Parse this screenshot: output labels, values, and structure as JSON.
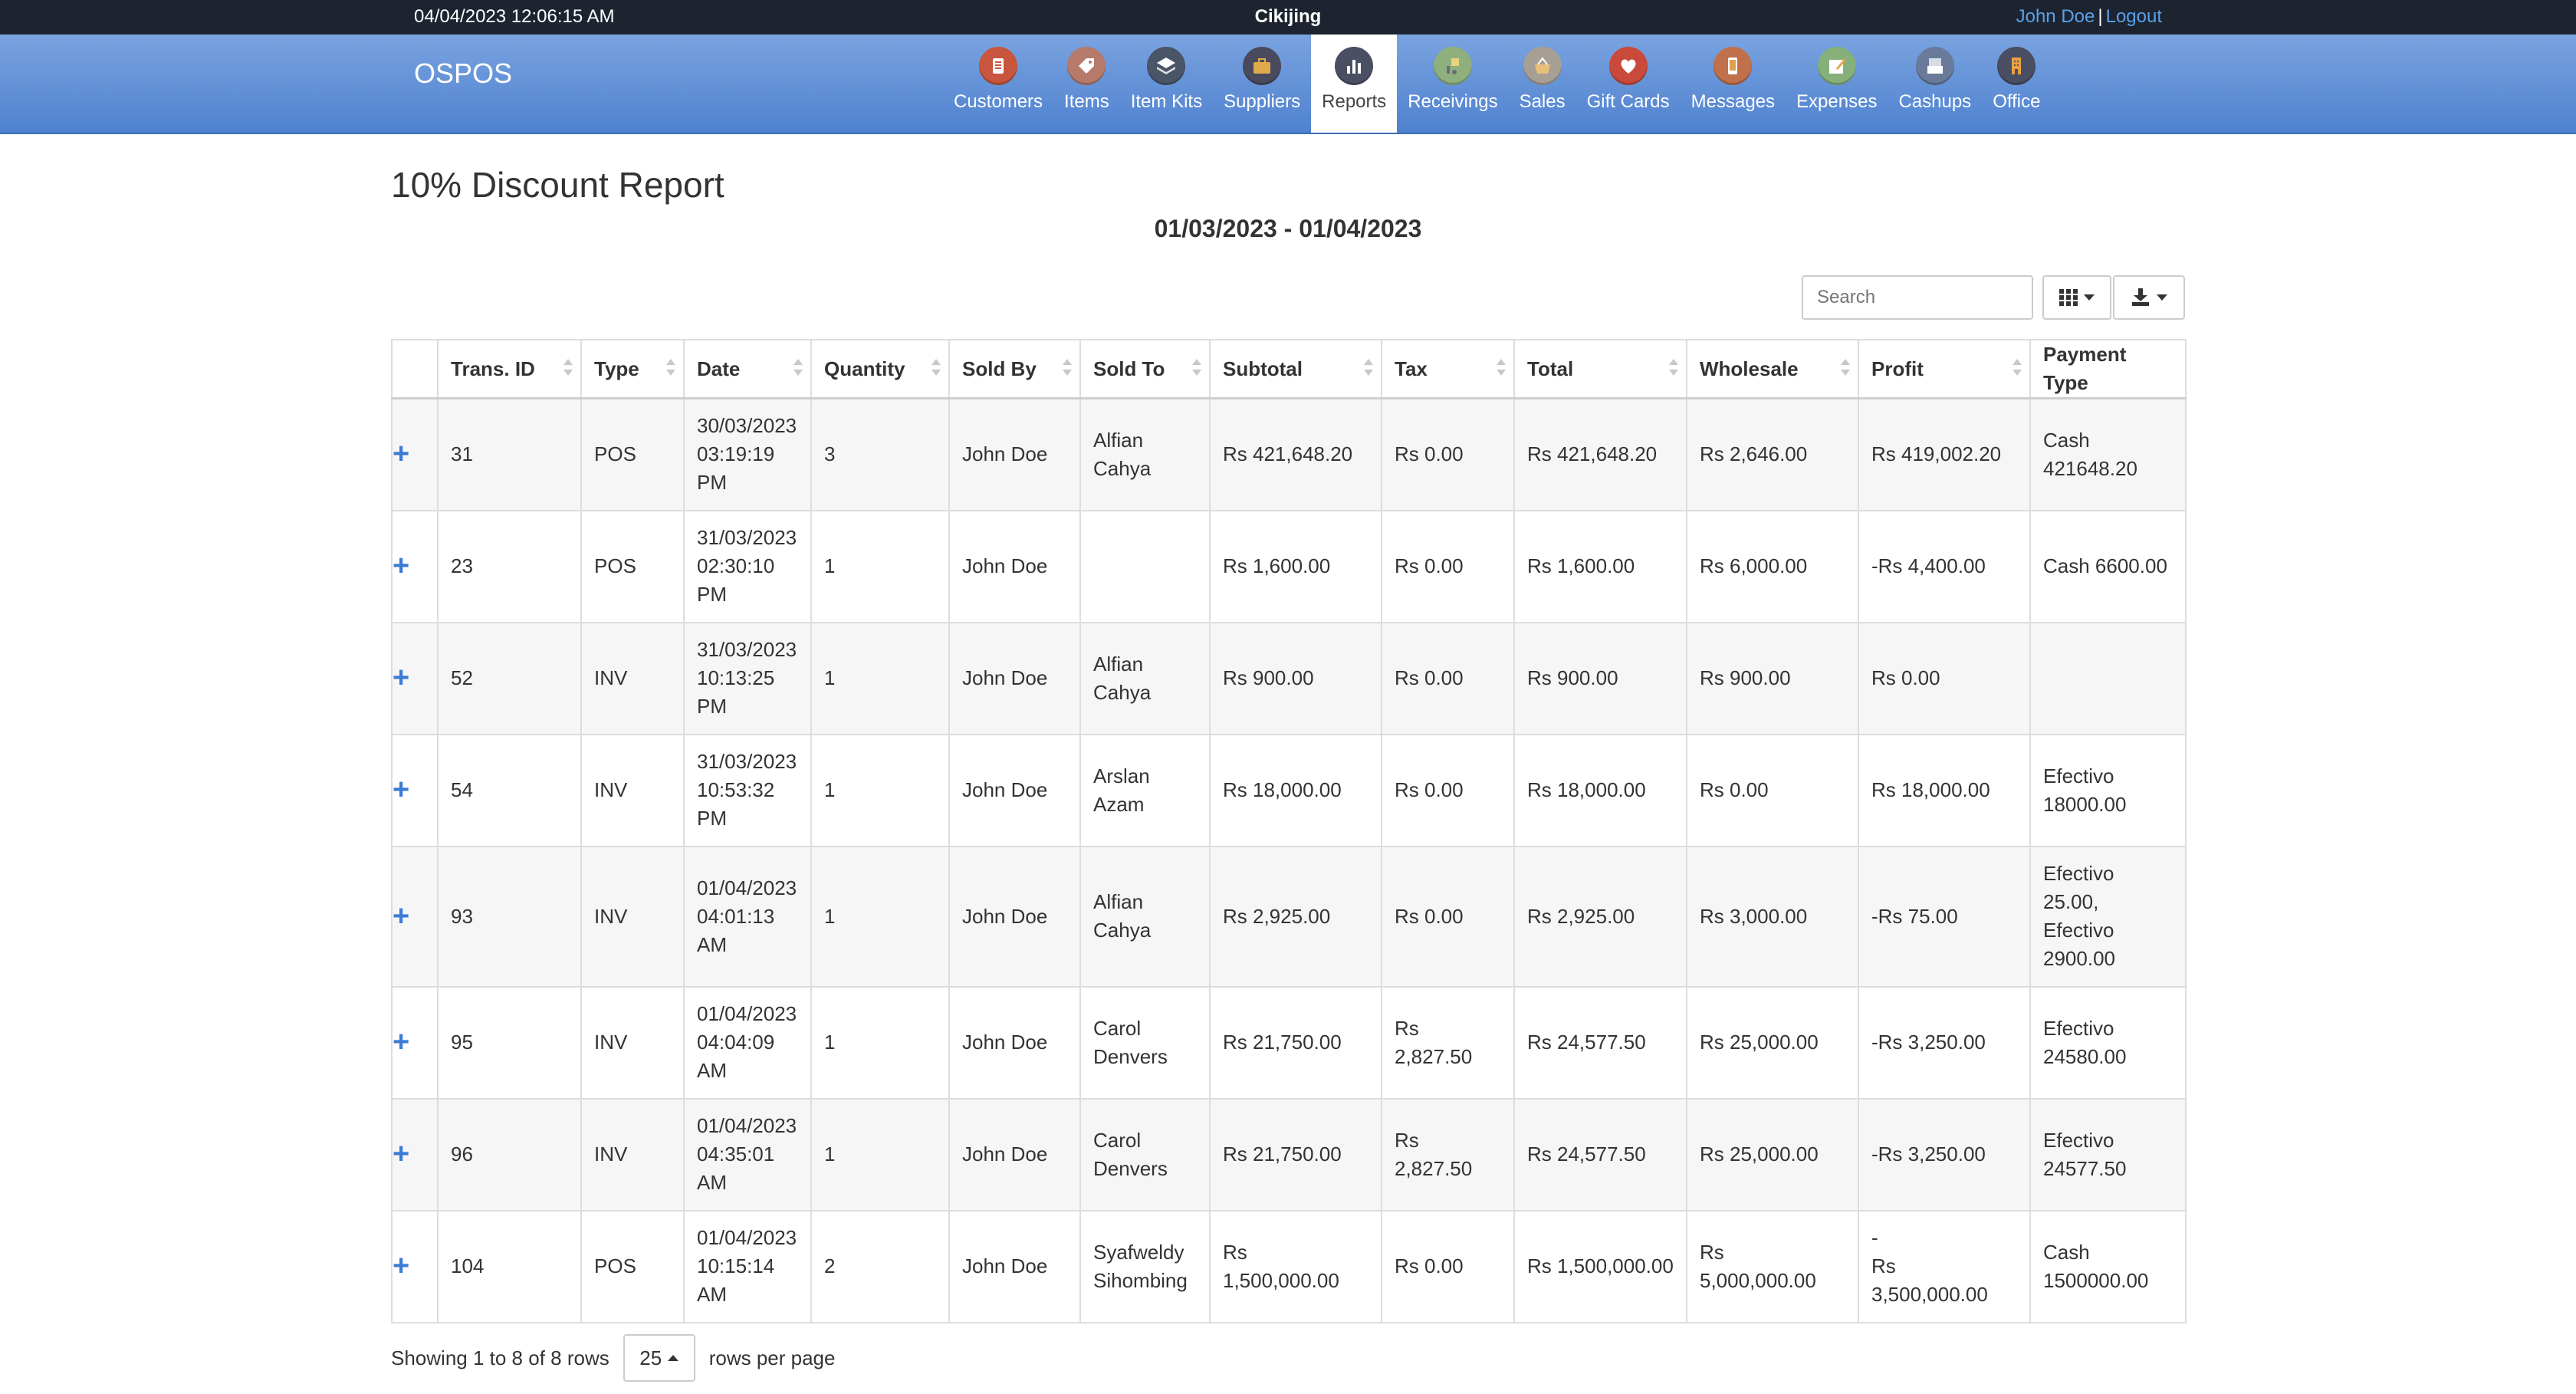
{
  "topbar": {
    "datetime": "04/04/2023 12:06:15 AM",
    "store": "Cikijing",
    "user": "John Doe",
    "separator": "|",
    "logout": "Logout"
  },
  "navbar": {
    "brand": "OSPOS",
    "items": [
      {
        "label": "Customers",
        "icon": "address-book-icon",
        "color": "#c8553d"
      },
      {
        "label": "Items",
        "icon": "tag-icon",
        "color": "#b57a6a"
      },
      {
        "label": "Item Kits",
        "icon": "layers-icon",
        "color": "#4a5568"
      },
      {
        "label": "Suppliers",
        "icon": "briefcase-icon",
        "color": "#4a4a5e"
      },
      {
        "label": "Reports",
        "icon": "bar-chart-icon",
        "color": "#4a4f63"
      },
      {
        "label": "Receivings",
        "icon": "delivery-icon",
        "color": "#8fb07c"
      },
      {
        "label": "Sales",
        "icon": "shopping-basket-icon",
        "color": "#a89f94"
      },
      {
        "label": "Gift Cards",
        "icon": "heart-icon",
        "color": "#c94a3a"
      },
      {
        "label": "Messages",
        "icon": "phone-icon",
        "color": "#c0704a"
      },
      {
        "label": "Expenses",
        "icon": "pencil-icon",
        "color": "#86b07a"
      },
      {
        "label": "Cashups",
        "icon": "cash-register-icon",
        "color": "#6a7a9a"
      },
      {
        "label": "Office",
        "icon": "building-icon",
        "color": "#4a4e63"
      }
    ],
    "active": "Reports"
  },
  "report": {
    "title": "10% Discount Report",
    "date_range": "01/03/2023 - 01/04/2023"
  },
  "toolbar": {
    "search_placeholder": "Search"
  },
  "table": {
    "columns": [
      "Trans. ID",
      "Type",
      "Date",
      "Quantity",
      "Sold By",
      "Sold To",
      "Subtotal",
      "Tax",
      "Total",
      "Wholesale",
      "Profit",
      "Payment Type"
    ],
    "rows": [
      {
        "id": "31",
        "type": "POS",
        "date": "30/03/2023\n03:19:19\nPM",
        "quantity": "3",
        "sold_by": "John Doe",
        "sold_to": "Alfian\nCahya",
        "subtotal": "Rs 421,648.20",
        "tax": "Rs 0.00",
        "total": "Rs 421,648.20",
        "wholesale": "Rs 2,646.00",
        "profit": "Rs 419,002.20",
        "payment": "Cash\n421648.20"
      },
      {
        "id": "23",
        "type": "POS",
        "date": "31/03/2023\n02:30:10\nPM",
        "quantity": "1",
        "sold_by": "John Doe",
        "sold_to": "",
        "subtotal": "Rs 1,600.00",
        "tax": "Rs 0.00",
        "total": "Rs 1,600.00",
        "wholesale": "Rs 6,000.00",
        "profit": "-Rs 4,400.00",
        "payment": "Cash 6600.00"
      },
      {
        "id": "52",
        "type": "INV",
        "date": "31/03/2023\n10:13:25\nPM",
        "quantity": "1",
        "sold_by": "John Doe",
        "sold_to": "Alfian\nCahya",
        "subtotal": "Rs 900.00",
        "tax": "Rs 0.00",
        "total": "Rs 900.00",
        "wholesale": "Rs 900.00",
        "profit": "Rs 0.00",
        "payment": ""
      },
      {
        "id": "54",
        "type": "INV",
        "date": "31/03/2023\n10:53:32\nPM",
        "quantity": "1",
        "sold_by": "John Doe",
        "sold_to": "Arslan\nAzam",
        "subtotal": "Rs 18,000.00",
        "tax": "Rs 0.00",
        "total": "Rs 18,000.00",
        "wholesale": "Rs 0.00",
        "profit": "Rs 18,000.00",
        "payment": "Efectivo\n18000.00"
      },
      {
        "id": "93",
        "type": "INV",
        "date": "01/04/2023\n04:01:13\nAM",
        "quantity": "1",
        "sold_by": "John Doe",
        "sold_to": "Alfian\nCahya",
        "subtotal": "Rs 2,925.00",
        "tax": "Rs 0.00",
        "total": "Rs 2,925.00",
        "wholesale": "Rs 3,000.00",
        "profit": "-Rs 75.00",
        "payment": "Efectivo\n25.00,\nEfectivo\n2900.00"
      },
      {
        "id": "95",
        "type": "INV",
        "date": "01/04/2023\n04:04:09\nAM",
        "quantity": "1",
        "sold_by": "John Doe",
        "sold_to": "Carol\nDenvers",
        "subtotal": "Rs 21,750.00",
        "tax": "Rs 2,827.50",
        "total": "Rs 24,577.50",
        "wholesale": "Rs 25,000.00",
        "profit": "-Rs 3,250.00",
        "payment": "Efectivo\n24580.00"
      },
      {
        "id": "96",
        "type": "INV",
        "date": "01/04/2023\n04:35:01\nAM",
        "quantity": "1",
        "sold_by": "John Doe",
        "sold_to": "Carol\nDenvers",
        "subtotal": "Rs 21,750.00",
        "tax": "Rs 2,827.50",
        "total": "Rs 24,577.50",
        "wholesale": "Rs 25,000.00",
        "profit": "-Rs 3,250.00",
        "payment": "Efectivo\n24577.50"
      },
      {
        "id": "104",
        "type": "POS",
        "date": "01/04/2023\n10:15:14\nAM",
        "quantity": "2",
        "sold_by": "John Doe",
        "sold_to": "Syafweldy\nSihombing",
        "subtotal": "Rs 1,500,000.00",
        "tax": "Rs 0.00",
        "total": "Rs 1,500,000.00",
        "wholesale": "Rs 5,000,000.00",
        "profit": "-\nRs 3,500,000.00",
        "payment": "Cash\n1500000.00"
      }
    ]
  },
  "footer": {
    "showing": "Showing 1 to 8 of 8 rows",
    "page_size": "25",
    "rows_per_page": "rows per page"
  }
}
